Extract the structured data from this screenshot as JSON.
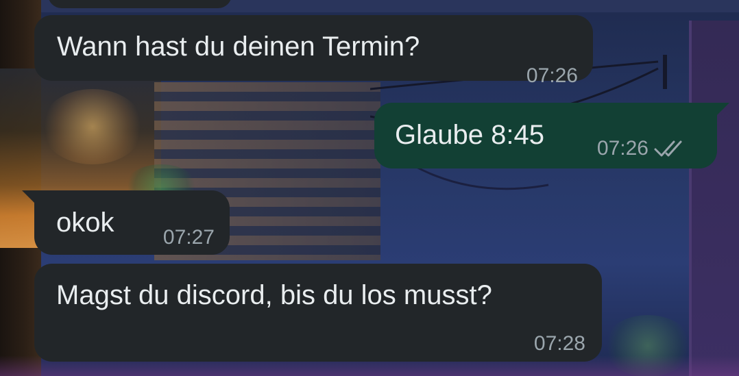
{
  "chat": {
    "messages": [
      {
        "direction": "incoming",
        "text": "Wann hast du deinen Termin?",
        "time": "07:26"
      },
      {
        "direction": "outgoing",
        "text": "Glaube 8:45",
        "time": "07:26",
        "status_icon": "double-check-read-icon"
      },
      {
        "direction": "incoming",
        "text": "okok",
        "time": "07:27"
      },
      {
        "direction": "incoming",
        "text": "Magst du discord, bis du los musst?",
        "time": "07:28"
      }
    ]
  },
  "colors": {
    "incoming_bubble": "#222629",
    "outgoing_bubble": "#124034",
    "text": "#e9edef",
    "meta": "#9ba6ad"
  }
}
